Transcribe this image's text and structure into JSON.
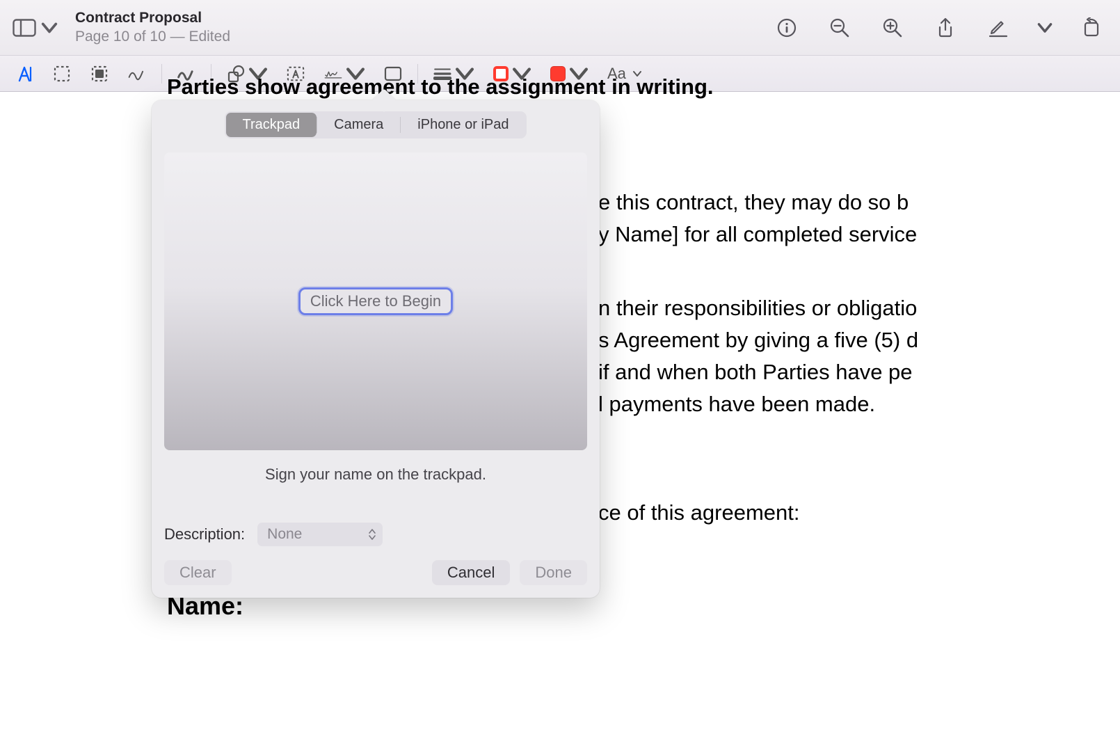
{
  "header": {
    "title": "Contract Proposal",
    "subtitle": "Page 10 of 10 — Edited"
  },
  "document": {
    "line_top": "Parties show agreement to the assignment in writing.",
    "line1": "e this contract, they may do so b",
    "line2": "y Name] for all completed service",
    "line3": "n their responsibilities or obligatio",
    "line4": "s Agreement by giving a five (5) d",
    "line5": "if and when both Parties have pe",
    "line6": "l payments have been made.",
    "line7": "ce of this agreement:",
    "name_label": "Name:"
  },
  "markup": {
    "text_style_label": "Aa"
  },
  "popover": {
    "tabs": {
      "trackpad": "Trackpad",
      "camera": "Camera",
      "device": "iPhone or iPad"
    },
    "begin": "Click Here to Begin",
    "hint": "Sign your name on the trackpad.",
    "description_label": "Description:",
    "description_value": "None",
    "clear": "Clear",
    "cancel": "Cancel",
    "done": "Done"
  }
}
